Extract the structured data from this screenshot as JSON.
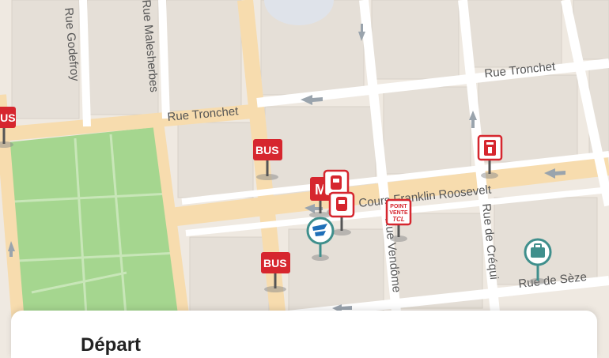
{
  "map": {
    "streets": {
      "rue_godefroy": "Rue Godefroy",
      "rue_malesherbes": "Rue Malesherbes",
      "rue_tronchet_left": "Rue Tronchet",
      "rue_tronchet_right": "Rue Tronchet",
      "cours_franklin_roosevelt": "Cours Franklin Roosevelt",
      "rue_vendome": "Rue Vendôme",
      "rue_de_crequi": "Rue de Créqui",
      "rue_de_seze": "Rue de Sèze"
    },
    "markers": {
      "bus_label": "BUS",
      "metro_label": "M",
      "point_vente_line1": "POINT",
      "point_vente_line2": "VENTE",
      "point_vente_line3": "TCL"
    },
    "colors": {
      "background": "#efe9e1",
      "park": "#a5d68f",
      "main_road": "#f7dcae",
      "block": "#e5dfd7",
      "transit_red": "#d6262e",
      "teal": "#3f8f8c"
    }
  },
  "sheet": {
    "title": "Départ"
  }
}
